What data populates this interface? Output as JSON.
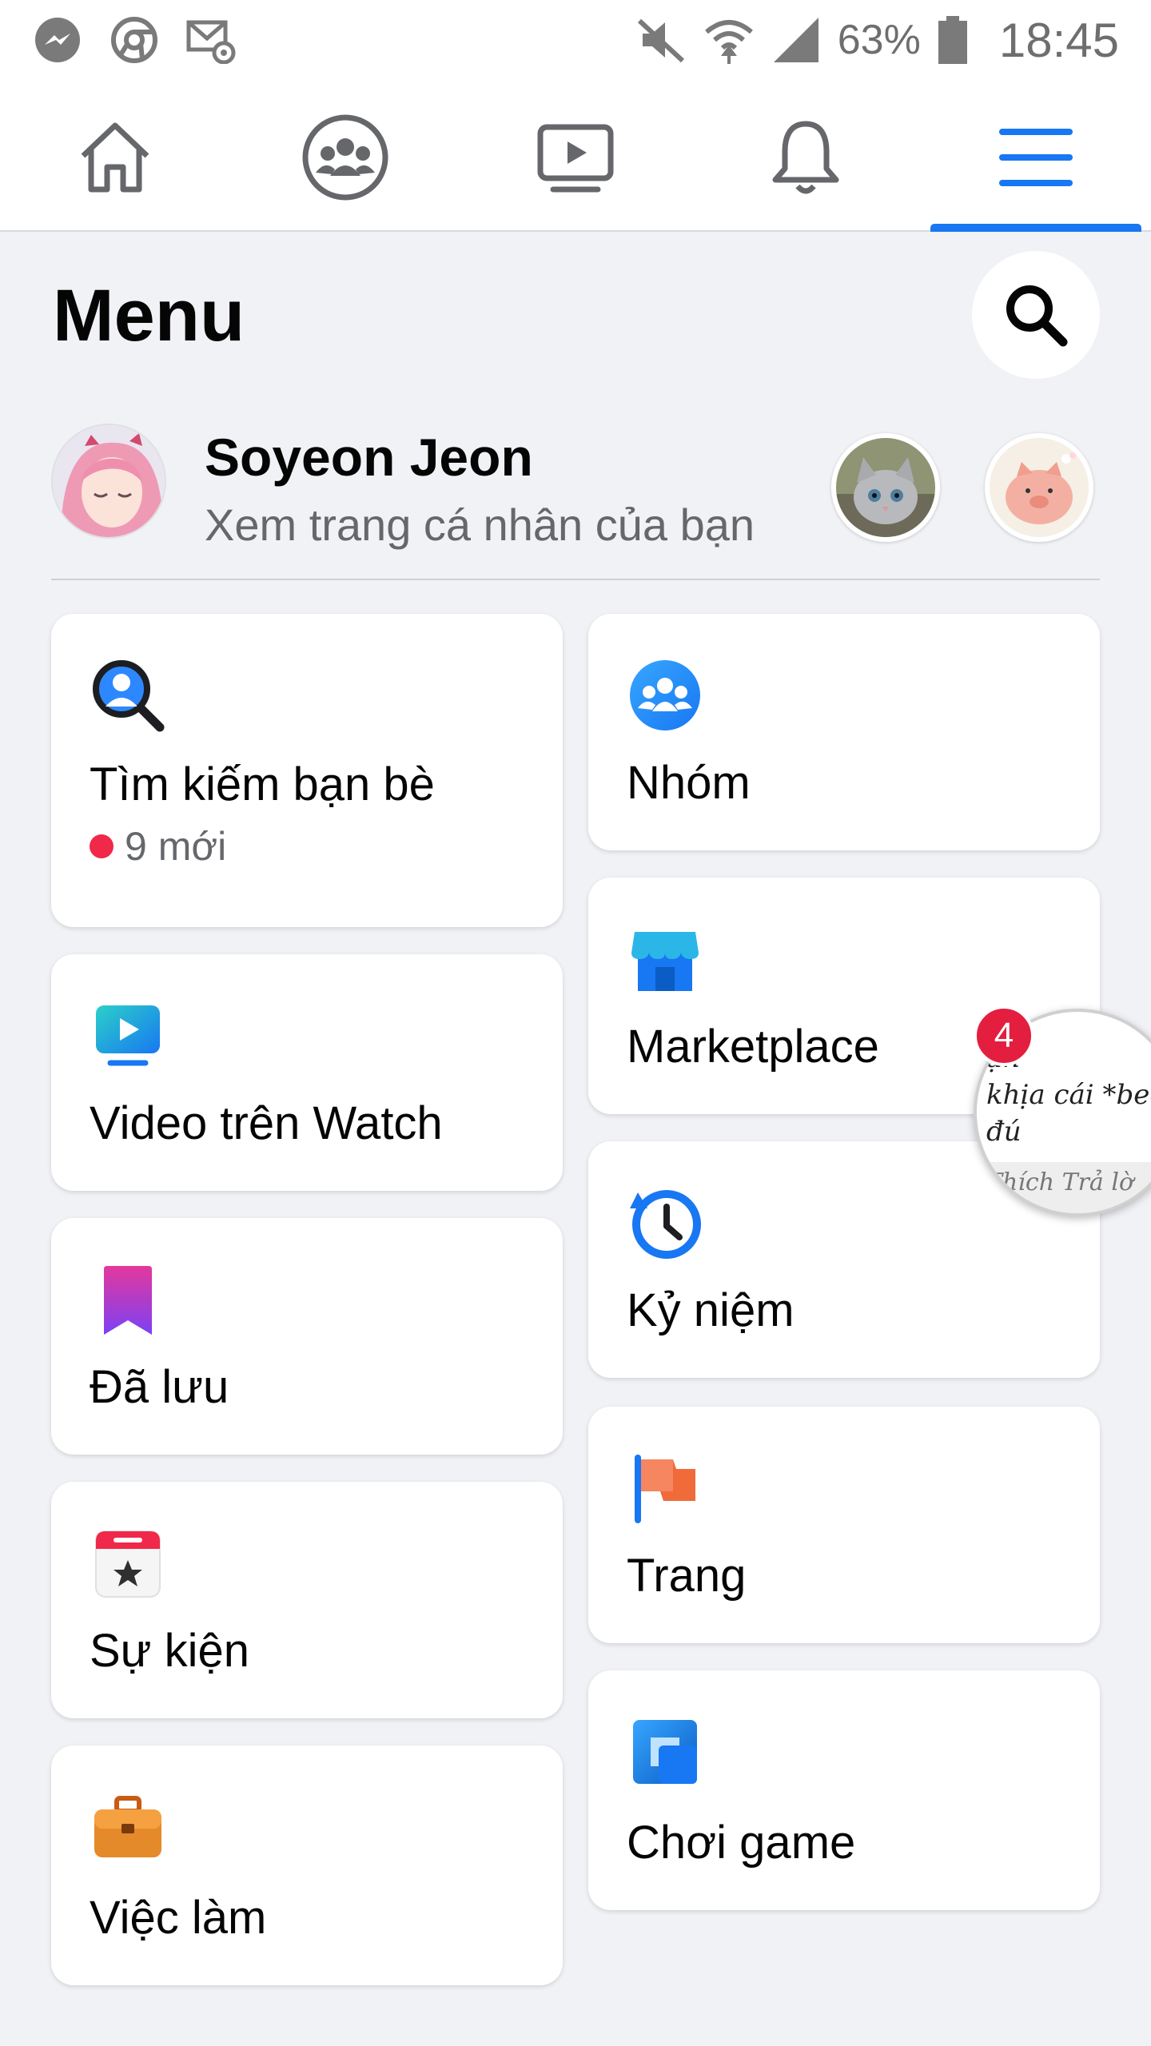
{
  "status_bar": {
    "battery_text": "63%",
    "time": "18:45",
    "left_icons": [
      "messenger-icon",
      "chrome-icon",
      "mail-at-icon"
    ],
    "right_icons": [
      "mute-icon",
      "wifi-icon",
      "signal-icon",
      "battery-icon"
    ]
  },
  "nav": {
    "items": [
      "home-icon",
      "groups-icon",
      "watch-icon",
      "notifications-icon",
      "menu-icon"
    ],
    "active": "menu-icon",
    "accent": "#1877f2"
  },
  "header": {
    "title": "Menu"
  },
  "profile": {
    "name": "Soyeon Jeon",
    "subtitle": "Xem trang cá nhân của bạn"
  },
  "shortcuts_left": [
    {
      "label": "Tìm kiếm bạn bè",
      "icon": "find-friends-icon",
      "sub": "9 mới"
    },
    {
      "label": "Video trên Watch",
      "icon": "watch-video-icon"
    },
    {
      "label": "Đã lưu",
      "icon": "saved-bookmark-icon"
    },
    {
      "label": "Sự kiện",
      "icon": "events-calendar-icon"
    },
    {
      "label": "Việc làm",
      "icon": "jobs-briefcase-icon"
    }
  ],
  "shortcuts_right": [
    {
      "label": "Nhóm",
      "icon": "groups-icon"
    },
    {
      "label": "Marketplace",
      "icon": "marketplace-store-icon"
    },
    {
      "label": "Kỷ niệm",
      "icon": "memories-clock-icon"
    },
    {
      "label": "Trang",
      "icon": "pages-flag-icon"
    },
    {
      "label": "Chơi game",
      "icon": "gaming-icon"
    }
  ],
  "chat_head": {
    "badge": "4",
    "lines": [
      "ạn",
      "khịa cái *beep",
      "đú",
      "Thích   Trả lờ"
    ]
  }
}
